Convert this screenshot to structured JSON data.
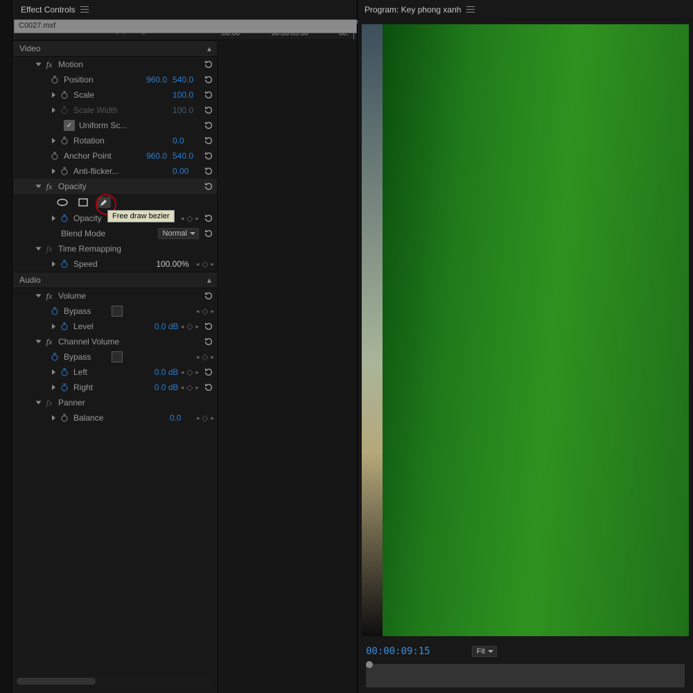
{
  "panels": {
    "effectControls": {
      "title": "Effect Controls"
    },
    "program": {
      "title": "Program: Key phong xanh"
    }
  },
  "breadcrumb": {
    "master": "Master * C0027.mxf",
    "sequence": "Key phong xanh *..."
  },
  "sections": {
    "video": "Video",
    "audio": "Audio"
  },
  "motion": {
    "name": "Motion",
    "position": {
      "label": "Position",
      "x": "960.0",
      "y": "540.0"
    },
    "scale": {
      "label": "Scale",
      "value": "100.0"
    },
    "scaleWidth": {
      "label": "Scale Width",
      "value": "100.0"
    },
    "uniform": {
      "label": "Uniform Sc..."
    },
    "rotation": {
      "label": "Rotation",
      "value": "0.0"
    },
    "anchor": {
      "label": "Anchor Point",
      "x": "960.0",
      "y": "540.0"
    },
    "antiFlicker": {
      "label": "Anti-flicker...",
      "value": "0.00"
    }
  },
  "opacity": {
    "name": "Opacity",
    "tooltip": "Free draw bezier",
    "opacity": {
      "label": "Opacity"
    },
    "blendMode": {
      "label": "Blend Mode",
      "value": "Normal"
    }
  },
  "timeRemap": {
    "name": "Time Remapping",
    "speed": {
      "label": "Speed",
      "value": "100.00%"
    }
  },
  "volume": {
    "name": "Volume",
    "bypass": {
      "label": "Bypass"
    },
    "level": {
      "label": "Level",
      "value": "0.0 dB"
    }
  },
  "channelVolume": {
    "name": "Channel Volume",
    "bypass": {
      "label": "Bypass"
    },
    "left": {
      "label": "Left",
      "value": "0.0 dB"
    },
    "right": {
      "label": "Right",
      "value": "0.0 dB"
    }
  },
  "panner": {
    "name": "Panner",
    "balance": {
      "label": "Balance",
      "value": "0.0"
    }
  },
  "timeline": {
    "tick1": ":00:00",
    "tick2": "00:00:05:00",
    "tick3": "00:",
    "clip": "C0027.mxf"
  },
  "program": {
    "timecode": "00:00:09:15",
    "zoom": "Fit"
  }
}
